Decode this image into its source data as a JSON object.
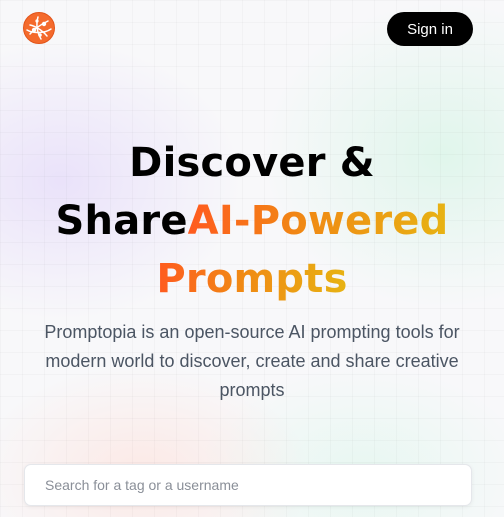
{
  "header": {
    "logo_icon": "promptopia-globe-icon",
    "sign_in_label": "Sign in"
  },
  "hero": {
    "title_line1": "Discover &",
    "title_line2_plain": "Share",
    "title_line2_grad": "AI-Powered",
    "title_line3_grad": "Prompts",
    "description": "Promptopia is an open-source AI prompting tools for modern world to discover, create and share creative prompts"
  },
  "search": {
    "placeholder": "Search for a tag or a username",
    "value": ""
  },
  "colors": {
    "accent_orange": "#ff5a1f",
    "accent_yellow": "#e7b313",
    "text_gray": "#4b5563"
  }
}
